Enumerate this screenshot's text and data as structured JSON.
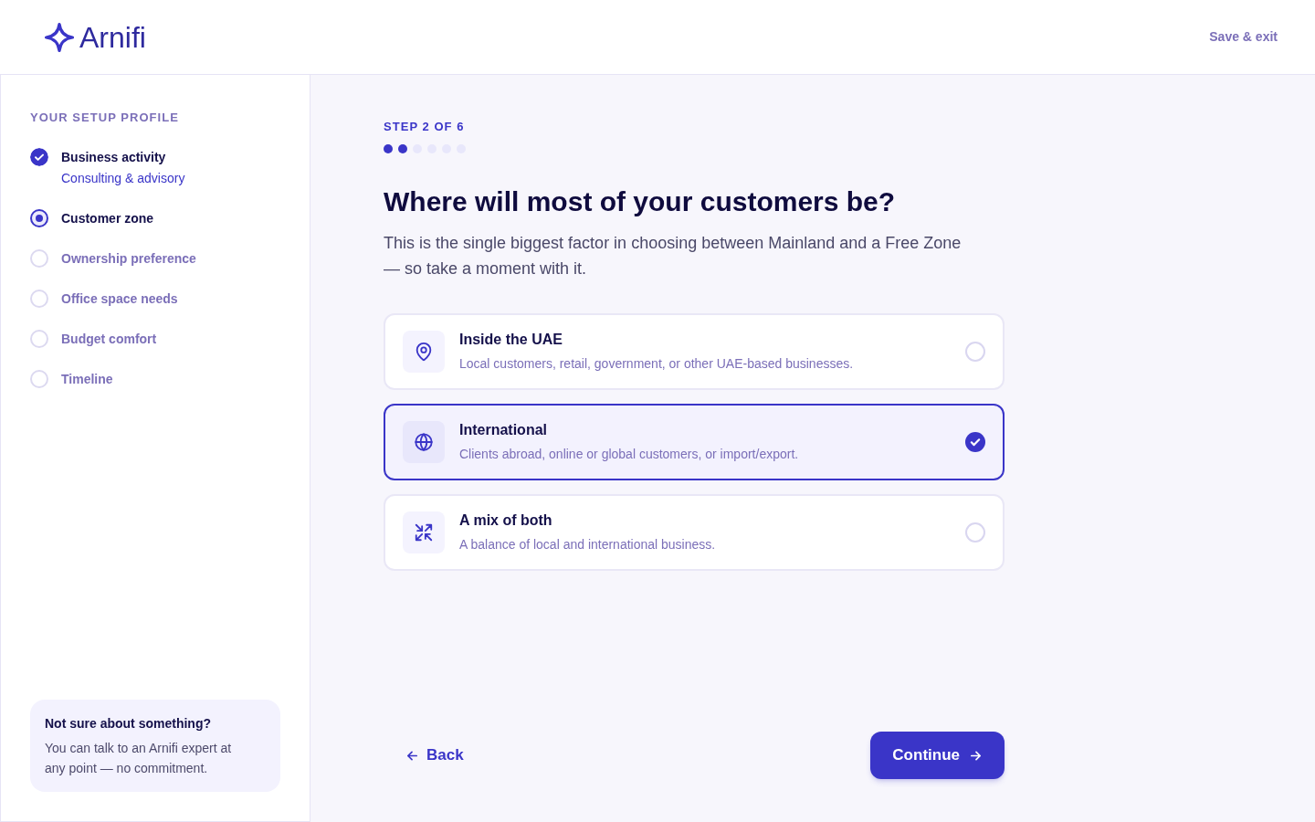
{
  "header": {
    "logo": "Arnifi",
    "save_exit": "Save & exit"
  },
  "sidebar": {
    "heading": "YOUR SETUP PROFILE",
    "steps": [
      {
        "label": "Business activity",
        "completed": true,
        "selected": false,
        "answer": "Consulting & advisory"
      },
      {
        "label": "Customer zone",
        "completed": false,
        "selected": true
      },
      {
        "label": "Ownership preference",
        "completed": false,
        "selected": false
      },
      {
        "label": "Office space needs",
        "completed": false,
        "selected": false
      },
      {
        "label": "Budget comfort",
        "completed": false,
        "selected": false
      },
      {
        "label": "Timeline",
        "completed": false,
        "selected": false
      }
    ],
    "help": {
      "title": "Not sure about something?",
      "text": "You can talk to an Arnifi expert at any point — no commitment."
    }
  },
  "main": {
    "step_label": "STEP 2 OF 6",
    "progress_dots": [
      {
        "filled": true
      },
      {
        "filled": true
      },
      {
        "filled": false
      },
      {
        "filled": false
      },
      {
        "filled": false
      },
      {
        "filled": false
      }
    ],
    "title": "Where will most of your customers be?",
    "subtitle": "This is the single biggest factor in choosing between Mainland and a Free Zone — so take a moment with it.",
    "options": [
      {
        "title": "Inside the UAE",
        "description": "Local customers, retail, government, or other UAE-based businesses.",
        "selected": false
      },
      {
        "title": "International",
        "description": "Clients abroad, online or global customers, or import/export.",
        "selected": true
      },
      {
        "title": "A mix of both",
        "description": "A balance of local and international business.",
        "selected": false
      }
    ],
    "back": "Back",
    "continue": "Continue"
  }
}
